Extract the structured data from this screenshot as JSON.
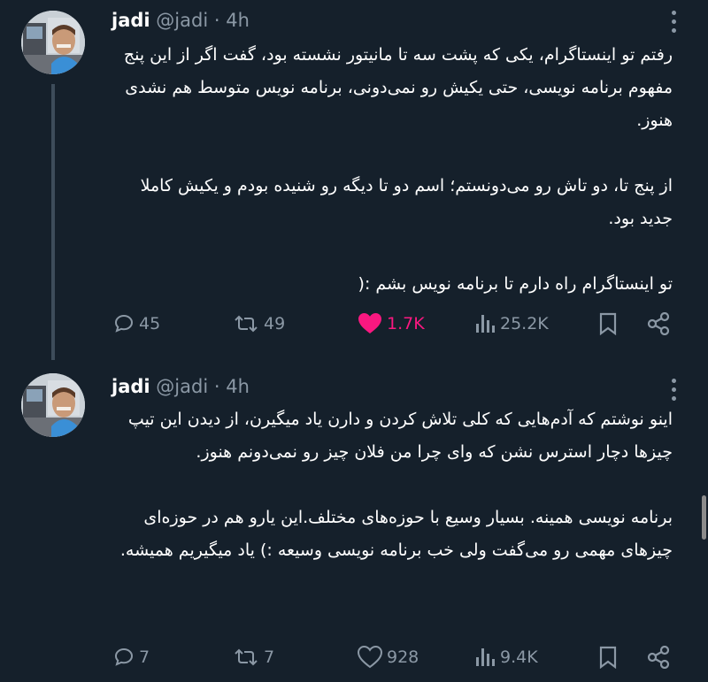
{
  "colors": {
    "background": "#15202b",
    "text": "#ffffff",
    "muted": "#8b98a5",
    "like_active": "#f91880",
    "thread_line": "#3d4c5a"
  },
  "tweets": [
    {
      "name": "jadi",
      "handle": "@jadi",
      "separator": "·",
      "time": "4h",
      "paragraphs": [
        "رفتم تو اینستاگرام، یکی که پشت سه تا مانیتور نشسته بود، گفت اگر از این پنج مفهوم برنامه نویسی، حتی یکیش رو نمی‌دونی، برنامه نویس متوسط هم نشدی هنوز.",
        "از پنج تا، دو تاش رو می‌دونستم؛ اسم دو تا دیگه رو شنیده بودم و یکیش کاملا جدید بود.",
        "تو اینستاگرام راه دارم تا برنامه نویس بشم :("
      ],
      "replies": "45",
      "retweets": "49",
      "likes": "1.7K",
      "liked": true,
      "views": "25.2K",
      "icons": [
        "reply-icon",
        "retweet-icon",
        "heart-icon",
        "views-icon",
        "bookmark-icon",
        "share-icon"
      ]
    },
    {
      "name": "jadi",
      "handle": "@jadi",
      "separator": "·",
      "time": "4h",
      "paragraphs": [
        "اینو نوشتم که آدم‌هایی که کلی تلاش کردن و دارن یاد میگیرن، از دیدن این تیپ چیزها  دچار استرس نشن که وای چرا من فلان چیز رو نمی‌دونم هنوز.",
        "برنامه نویسی همینه. بسیار وسیع با حوزه‌های مختلف.این یارو هم در حوزه‌ای چیزهای مهمی رو می‌گفت ولی خب برنامه نویسی وسیعه :) یاد میگیریم همیشه."
      ],
      "replies": "7",
      "retweets": "7",
      "likes": "928",
      "liked": false,
      "views": "9.4K",
      "icons": [
        "reply-icon",
        "retweet-icon",
        "heart-icon",
        "views-icon",
        "bookmark-icon",
        "share-icon"
      ]
    }
  ]
}
